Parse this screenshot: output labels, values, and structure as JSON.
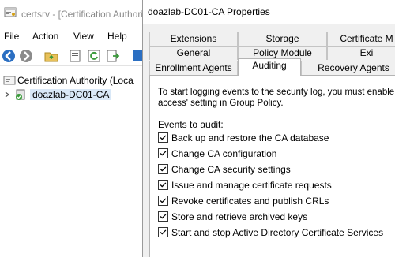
{
  "mmc": {
    "title": "certsrv - [Certification Authori",
    "menu": [
      "File",
      "Action",
      "View",
      "Help"
    ],
    "toolbar_icons": [
      "back-arrow-icon",
      "forward-arrow-icon",
      "folder-up-icon",
      "properties-icon",
      "refresh-icon",
      "export-list-icon",
      "help-icon"
    ],
    "tree": {
      "root_label": "Certification Authority (Loca",
      "child_label": "doazlab-DC01-CA"
    }
  },
  "dialog": {
    "title": "doazlab-DC01-CA Properties",
    "tabs_row1": [
      "Extensions",
      "Storage",
      "Certificate M"
    ],
    "tabs_row2": [
      "General",
      "Policy Module",
      "Exi"
    ],
    "tabs_row3": [
      "Enrollment Agents",
      "Auditing",
      "Recovery Agents"
    ],
    "active_tab": "Auditing",
    "intro_line1": "To start logging events to the security log, you must enable the",
    "intro_line2": "access' setting in Group Policy.",
    "events_label": "Events to audit:",
    "events": [
      {
        "label": "Back up and restore the CA database",
        "checked": true
      },
      {
        "label": "Change CA configuration",
        "checked": true
      },
      {
        "label": "Change CA security settings",
        "checked": true
      },
      {
        "label": "Issue and manage certificate requests",
        "checked": true
      },
      {
        "label": "Revoke certificates and publish CRLs",
        "checked": true
      },
      {
        "label": "Store and retrieve archived keys",
        "checked": true
      },
      {
        "label": "Start and stop Active Directory Certificate Services",
        "checked": true
      }
    ]
  },
  "colors": {
    "accent_blue": "#2b6fc2",
    "green": "#3a9a3a",
    "selection": "#d9e8f7"
  }
}
